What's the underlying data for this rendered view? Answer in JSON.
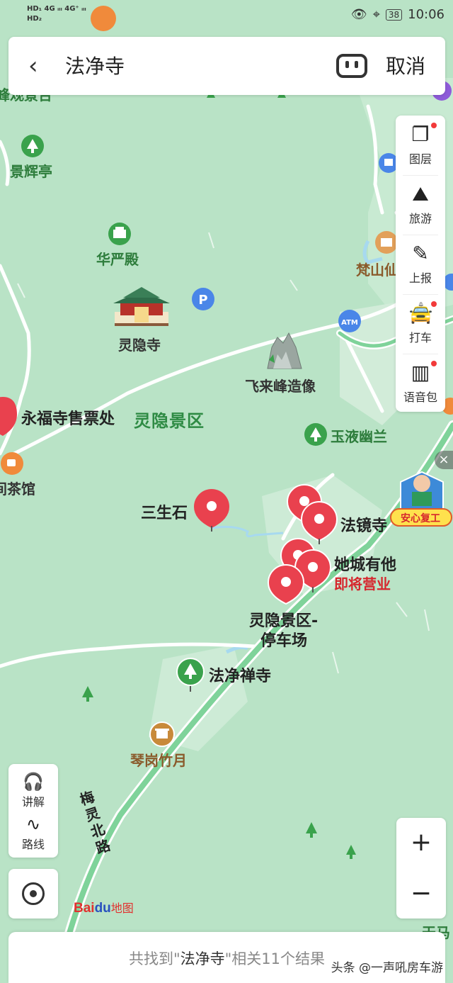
{
  "status_bar": {
    "left_top": "HD₁ 4G ᵢₗₗ 4G⁺ ᵢₗₗ",
    "left_bottom": "HD₂",
    "battery": "38",
    "time": "10:06"
  },
  "search": {
    "query": "法净寺",
    "cancel_label": "取消"
  },
  "map_labels": {
    "top_left_partial": "峰观景台",
    "jinghui": "景辉亭",
    "huayan": "华严殿",
    "lingyin_temple": "灵隐寺",
    "feilai": "飞来峰造像",
    "fanshan": "梵山仙",
    "yongfu": "永福寺售票处",
    "lingyin_scenic": "灵隐景区",
    "yuye": "玉液幽兰",
    "teahouse": "间茶馆",
    "sansheng": "三生石",
    "fajing": "法镜寺",
    "tacheng": "她城有他",
    "tacheng_status": "即将营业",
    "parking_line1": "灵隐景区-",
    "parking_line2": "停车场",
    "fajingchan": "法净禅寺",
    "qingang": "琴岗竹月",
    "road_meiling": "梅灵北路",
    "bottom_right_partial": "天马"
  },
  "tools": [
    {
      "label": "图层",
      "icon": "layers-icon"
    },
    {
      "label": "旅游",
      "icon": "travel-icon"
    },
    {
      "label": "上报",
      "icon": "report-icon"
    },
    {
      "label": "打车",
      "icon": "taxi-icon"
    },
    {
      "label": "语音包",
      "icon": "voice-pack-icon"
    }
  ],
  "left_panel": {
    "explain_label": "讲解",
    "route_label": "路线"
  },
  "zoom": {
    "in": "+",
    "out": "−"
  },
  "logo": {
    "b1": "Bai",
    "b2": "du",
    "b3": "地图"
  },
  "badge": {
    "text": "安心复工"
  },
  "results": {
    "prefix": "共找到\"",
    "keyword": "法净寺",
    "suffix": "\"相关11个结果"
  },
  "watermark": "头条 @一声吼房车游",
  "colors": {
    "map_bg": "#b9e3c6",
    "road": "#ffffff",
    "highway": "#7fd39a",
    "pin_red": "#e9414e",
    "poi_green": "#3aa24c",
    "label_green": "#2e7d3c",
    "poi_orange": "#f08a3b",
    "poi_blue": "#4a86e8"
  }
}
